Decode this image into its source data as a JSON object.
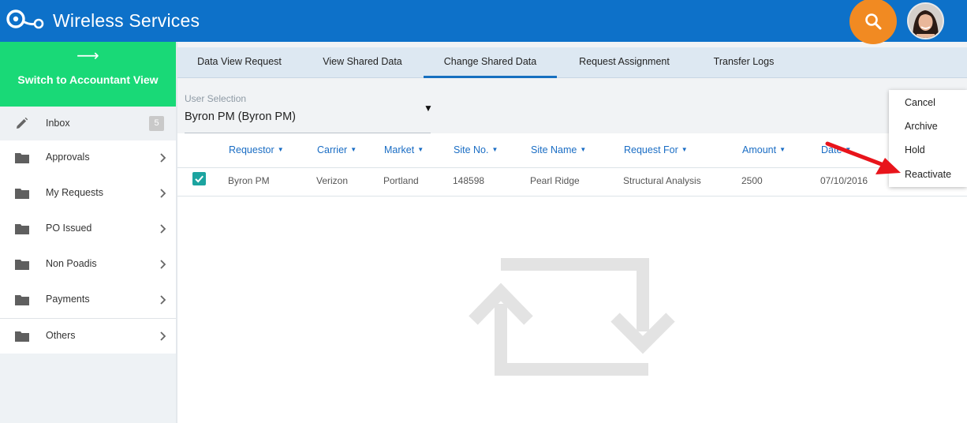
{
  "app": {
    "title": "Wireless Services"
  },
  "sidebar": {
    "switch_arrow": "⟶",
    "switch_label": "Switch to Accountant View",
    "items": [
      {
        "label": "Inbox",
        "icon": "pencil-icon",
        "badge": "5"
      },
      {
        "label": "Approvals",
        "icon": "folder-icon"
      },
      {
        "label": "My Requests",
        "icon": "folder-icon"
      },
      {
        "label": "PO Issued",
        "icon": "folder-icon"
      },
      {
        "label": "Non Poadis",
        "icon": "folder-icon"
      },
      {
        "label": "Payments",
        "icon": "folder-icon"
      },
      {
        "label": "Others",
        "icon": "folder-icon"
      }
    ]
  },
  "tabs": [
    {
      "label": "Data View Request"
    },
    {
      "label": "View Shared Data"
    },
    {
      "label": "Change Shared Data",
      "active": true
    },
    {
      "label": "Request Assignment"
    },
    {
      "label": "Transfer Logs"
    }
  ],
  "user_selection": {
    "label": "User Selection",
    "value": "Byron PM (Byron PM)"
  },
  "table": {
    "columns": [
      "Requestor",
      "Carrier",
      "Market",
      "Site No.",
      "Site Name",
      "Request For",
      "Amount",
      "Date"
    ],
    "rows": [
      {
        "checked": true,
        "cells": [
          "Byron PM",
          "Verizon",
          "Portland",
          "148598",
          "Pearl Ridge",
          "Structural Analysis",
          "2500",
          "07/10/2016"
        ]
      }
    ]
  },
  "menu": {
    "items": [
      "Cancel",
      "Archive",
      "Hold",
      "Reactivate"
    ]
  },
  "colors": {
    "topbar": "#0d71c9",
    "switch_view": "#19d977",
    "search_button": "#f18a22",
    "accent": "#1670c0",
    "checkbox": "#1ca4a0",
    "annotation_arrow": "#e8141b"
  }
}
